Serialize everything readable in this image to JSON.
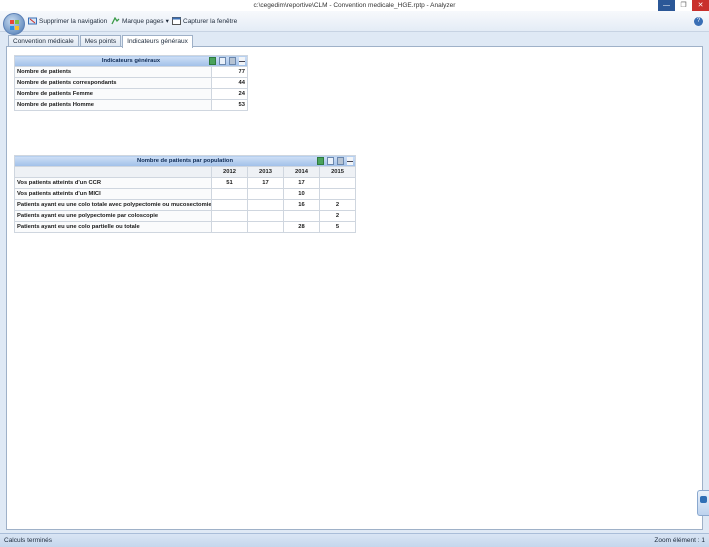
{
  "window": {
    "title": "c:\\cegedim\\reportive\\CLM - Convention medicale_HGE.rptp - Analyzer",
    "minimize_glyph": "—",
    "maximize_glyph": "❐",
    "close_glyph": "✕"
  },
  "toolbar": {
    "items": [
      {
        "label": "Supprimer la navigation",
        "icon": "remove-navigation-icon"
      },
      {
        "label": "Marque pages",
        "icon": "bookmark-icon",
        "dropdown": "▾"
      },
      {
        "label": "Capturer la fenêtre",
        "icon": "capture-window-icon"
      }
    ],
    "help_glyph": "?"
  },
  "tabs": [
    {
      "label": "Convention médicale",
      "active": false
    },
    {
      "label": "Mes points",
      "active": false
    },
    {
      "label": "Indicateurs généraux",
      "active": true
    }
  ],
  "indicateurs_table": {
    "title": "Indicateurs généraux",
    "rows": [
      {
        "label": "Nombre de patients",
        "value": "77"
      },
      {
        "label": "Nombre de patients correspondants",
        "value": "44"
      },
      {
        "label": "Nombre de patients Femme",
        "value": "24"
      },
      {
        "label": "Nombre de patients Homme",
        "value": "53"
      }
    ]
  },
  "population_table": {
    "title": "Nombre de patients par population",
    "years": [
      "2012",
      "2013",
      "2014",
      "2015"
    ],
    "rows": [
      {
        "label": "Vos patients atteints d'un CCR",
        "values": [
          "51",
          "17",
          "17",
          ""
        ]
      },
      {
        "label": "Vos patients atteints d'un MICI",
        "values": [
          "",
          "",
          "10",
          ""
        ]
      },
      {
        "label": "Patients ayant eu une colo totale avec polypectomie ou mucosectomie",
        "values": [
          "",
          "",
          "16",
          "2"
        ]
      },
      {
        "label": "Patients ayant eu une polypectomie par coloscopie",
        "values": [
          "",
          "",
          "",
          "2"
        ]
      },
      {
        "label": "Patients ayant eu une colo partielle ou totale",
        "values": [
          "",
          "",
          "28",
          "5"
        ]
      }
    ]
  },
  "status": {
    "left": "Calculs terminés",
    "right": "Zoom élément : 1"
  },
  "colors": {
    "header_gradient_top": "#cfe0f6",
    "header_gradient_bottom": "#9fbfe8",
    "panel_border": "#9fb1c8",
    "close_button": "#c9302c"
  }
}
